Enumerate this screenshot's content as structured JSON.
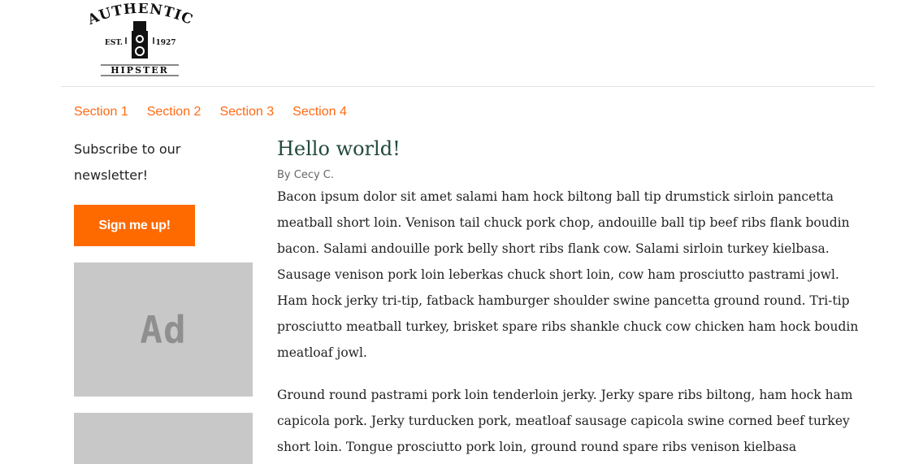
{
  "brand": {
    "top_text": "AUTHENTIC",
    "est_text": "EST.",
    "year_text": "1927",
    "bottom_text": "HIPSTER",
    "logo_icon": "camera-icon"
  },
  "nav": {
    "items": [
      {
        "label": "Section 1"
      },
      {
        "label": "Section 2"
      },
      {
        "label": "Section 3"
      },
      {
        "label": "Section 4"
      }
    ],
    "color": "#ff6a13"
  },
  "sidebar": {
    "newsletter_text": "Subscribe to our newsletter!",
    "signup_label": "Sign me up!",
    "signup_color": "#ff6a00",
    "ad_label": "Ad"
  },
  "article": {
    "title": "Hello world!",
    "byline": "By Cecy C.",
    "paragraphs": [
      "Bacon ipsum dolor sit amet salami ham hock biltong ball tip drumstick sirloin pancetta meatball short loin. Venison tail chuck pork chop, andouille ball tip beef ribs flank boudin bacon. Salami andouille pork belly short ribs flank cow. Salami sirloin turkey kielbasa. Sausage venison pork loin leberkas chuck short loin, cow ham prosciutto pastrami jowl. Ham hock jerky tri-tip, fatback hamburger shoulder swine pancetta ground round. Tri-tip prosciutto meatball turkey, brisket spare ribs shankle chuck cow chicken ham hock boudin meatloaf jowl.",
      "Ground round pastrami pork loin tenderloin jerky. Jerky spare ribs biltong, ham hock ham capicola pork. Jerky turducken pork, meatloaf sausage capicola swine corned beef turkey short loin. Tongue prosciutto pork loin, ground round spare ribs venison kielbasa"
    ],
    "title_color": "#234a3f"
  }
}
